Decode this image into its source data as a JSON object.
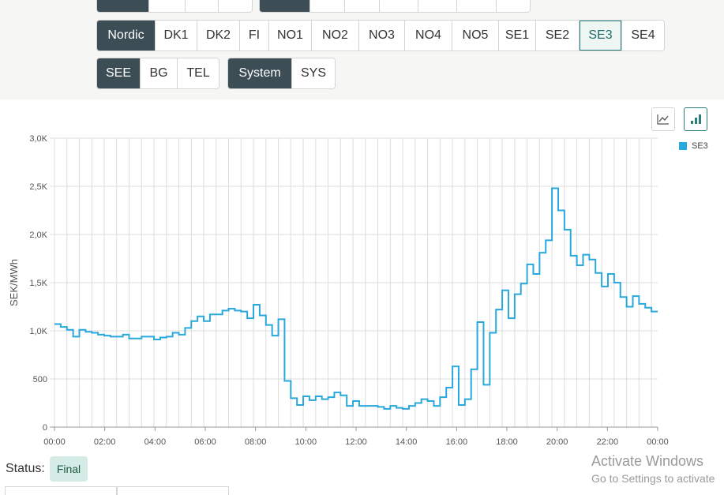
{
  "area_tabs": {
    "row1": [
      "Nordic",
      "DK1",
      "DK2",
      "FI",
      "NO1",
      "NO2",
      "NO3",
      "NO4",
      "NO5",
      "SE1",
      "SE2",
      "SE3",
      "SE4"
    ],
    "row2a": [
      "SEE",
      "BG",
      "TEL"
    ],
    "row2b": [
      "System",
      "SYS"
    ],
    "active": [
      "Nordic",
      "SEE",
      "System"
    ],
    "selected": "SE3"
  },
  "chart_controls": {
    "line_icon": "line-chart-icon",
    "bar_icon": "bar-chart-icon",
    "active": "bar"
  },
  "status": {
    "label": "Status:",
    "value": "Final"
  },
  "watermark": {
    "line1": "Activate Windows",
    "line2": "Go to Settings to activate"
  },
  "colors": {
    "series": "#29a8dc",
    "active_tab": "#3d4d55",
    "accent": "#2a7f7b",
    "badge_bg": "#d5ebe5"
  },
  "chart_data": {
    "type": "line",
    "step": true,
    "title": "",
    "xlabel": "",
    "ylabel": "SEK/MWh",
    "ylim": [
      0,
      3000
    ],
    "yticks": [
      0,
      500,
      1000,
      1500,
      2000,
      2500,
      3000
    ],
    "ytick_labels": [
      "0",
      "500",
      "1,0K",
      "1,5K",
      "2,0K",
      "2,5K",
      "3,0K"
    ],
    "xlim": [
      "00:00",
      "24:00"
    ],
    "xtick_labels": [
      "00:00",
      "02:00",
      "04:00",
      "06:00",
      "08:00",
      "10:00",
      "12:00",
      "14:00",
      "16:00",
      "18:00",
      "20:00",
      "22:00",
      "00:00"
    ],
    "interval": "15 min",
    "grid": true,
    "legend": "top-right",
    "series": [
      {
        "name": "SE3",
        "color": "#29a8dc",
        "values": [
          1070,
          1040,
          1010,
          940,
          1010,
          990,
          980,
          960,
          950,
          940,
          940,
          960,
          920,
          920,
          940,
          940,
          910,
          930,
          940,
          980,
          960,
          1030,
          1100,
          1150,
          1100,
          1170,
          1170,
          1210,
          1230,
          1210,
          1200,
          1130,
          1270,
          1160,
          1060,
          950,
          1120,
          480,
          300,
          230,
          320,
          280,
          320,
          290,
          310,
          360,
          330,
          220,
          270,
          220,
          220,
          220,
          210,
          190,
          220,
          200,
          190,
          220,
          250,
          290,
          270,
          220,
          310,
          410,
          630,
          230,
          290,
          600,
          1090,
          440,
          980,
          1220,
          1420,
          1130,
          1380,
          1490,
          1690,
          1590,
          1810,
          1940,
          2480,
          2250,
          2050,
          1780,
          1680,
          1790,
          1740,
          1600,
          1460,
          1590,
          1500,
          1350,
          1250,
          1360,
          1280,
          1240,
          1200
        ]
      }
    ]
  }
}
